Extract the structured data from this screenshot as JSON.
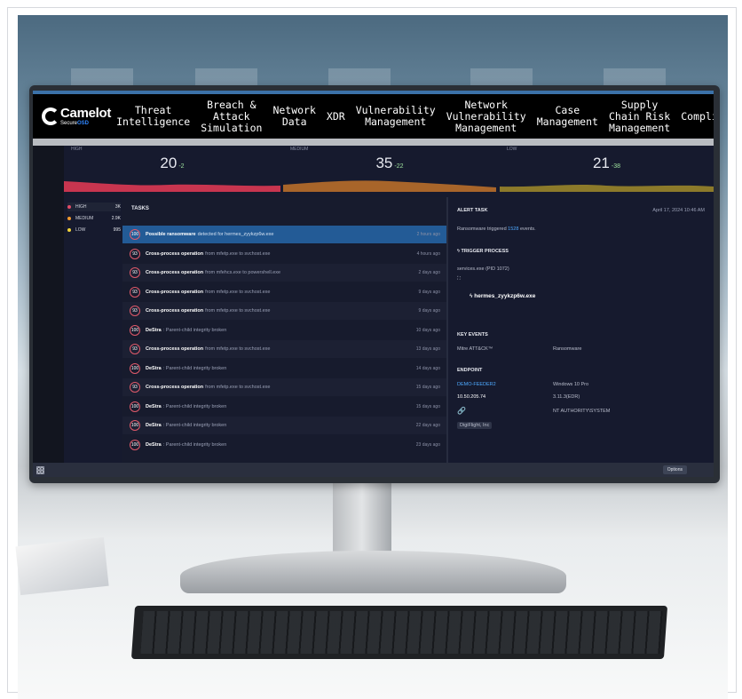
{
  "brand": {
    "name": "Camelot",
    "sub_prefix": "Secure",
    "sub_highlight": "OSD"
  },
  "nav": {
    "items": [
      "Threat\nIntelligence",
      "Breach &\nAttack\nSimulation",
      "Network\nData",
      "XDR",
      "Vulnerability\nManagement",
      "Network\nVulnerability\nManagement",
      "Case\nManagement",
      "Supply\nChain Risk\nManagement",
      "Compliance"
    ]
  },
  "stats": [
    {
      "label": "HIGH",
      "value": "20",
      "delta": "-2",
      "color": "#e24b66"
    },
    {
      "label": "MEDIUM",
      "value": "35",
      "delta": "-22",
      "color": "#f39a2d"
    },
    {
      "label": "LOW",
      "value": "21",
      "delta": "-38",
      "color": "#f2d43a"
    }
  ],
  "severity": [
    {
      "label": "HIGH",
      "count": "3K",
      "color": "#e24b66"
    },
    {
      "label": "MEDIUM",
      "count": "2.9K",
      "color": "#f39a2d"
    },
    {
      "label": "LOW",
      "count": "995",
      "color": "#f2d43a"
    }
  ],
  "tasks": {
    "title": "TASKS",
    "rows": [
      {
        "score": "100",
        "bold": "Possible ransomware",
        "rest": "detected for hermes_zyykzp6w.exe",
        "time": "2 hours ago"
      },
      {
        "score": "93",
        "bold": "Cross-process operation",
        "rest": "from mfetp.exe to svchost.exe",
        "time": "4 hours ago"
      },
      {
        "score": "93",
        "bold": "Cross-process operation",
        "rest": "from mfehcs.exe to powershell.exe",
        "time": "2 days ago"
      },
      {
        "score": "93",
        "bold": "Cross-process operation",
        "rest": "from mfetp.exe to svchost.exe",
        "time": "9 days ago"
      },
      {
        "score": "93",
        "bold": "Cross-process operation",
        "rest": "from mfetp.exe to svchost.exe",
        "time": "9 days ago"
      },
      {
        "score": "100",
        "bold": "DeStra",
        "rest": ": Parent-child integrity broken",
        "time": "10 days ago"
      },
      {
        "score": "93",
        "bold": "Cross-process operation",
        "rest": "from mfetp.exe to svchost.exe",
        "time": "13 days ago"
      },
      {
        "score": "100",
        "bold": "DeStra",
        "rest": ": Parent-child integrity broken",
        "time": "14 days ago"
      },
      {
        "score": "93",
        "bold": "Cross-process operation",
        "rest": "from mfetp.exe to svchost.exe",
        "time": "15 days ago"
      },
      {
        "score": "100",
        "bold": "DeStra",
        "rest": ": Parent-child integrity broken",
        "time": "15 days ago"
      },
      {
        "score": "100",
        "bold": "DeStra",
        "rest": ": Parent-child integrity broken",
        "time": "22 days ago"
      },
      {
        "score": "100",
        "bold": "DeStra",
        "rest": ": Parent-child integrity broken",
        "time": "23 days ago"
      }
    ]
  },
  "alert": {
    "title": "ALERT TASK",
    "date": "April 17, 2024 10:46 AM",
    "summary_prefix": "Ransomware triggered",
    "summary_count": "1528",
    "summary_suffix": "events.",
    "trigger_title": "TRIGGER PROCESS",
    "parent_proc": "services.exe (PID 1072)",
    "child_proc": "hermes_zyykzp6w.exe",
    "key_events_title": "KEY EVENTS",
    "key_event_1": "Mitre ATT&CK™",
    "key_event_2": "Ransomware",
    "endpoint_title": "ENDPOINT",
    "endpoint_name": "DEMO-FEEDER2",
    "endpoint_ip": "10.50.205.74",
    "endpoint_os": "Windows 10 Pro",
    "endpoint_version": "3.11.3(EDR)",
    "endpoint_user": "NT AUTHORITY\\SYSTEM",
    "endpoint_tag": "DigiFlight, Inc"
  },
  "bottombar": {
    "options": "Options"
  },
  "colors": {
    "accent": "#235b96",
    "link": "#4ea9ff",
    "nav_bg": "#000000"
  }
}
